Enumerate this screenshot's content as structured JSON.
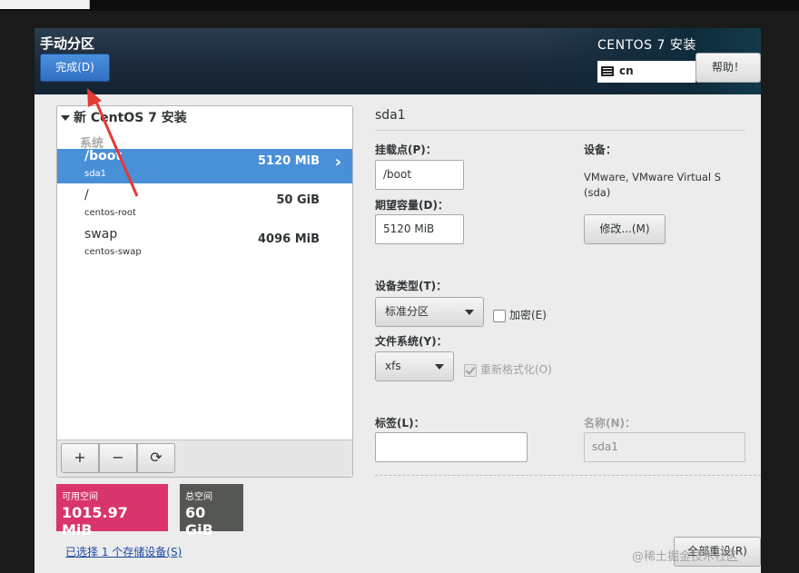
{
  "header": {
    "page_title": "手动分区",
    "done_label": "完成(D)",
    "product_title": "CENTOS 7 安装",
    "keyboard_layout": "cn",
    "help_label": "帮助！"
  },
  "partitions": {
    "install_label": "新 CentOS 7 安装",
    "system_label": "系统",
    "items": [
      {
        "mount": "/boot",
        "device": "sda1",
        "size": "5120 MiB",
        "selected": true
      },
      {
        "mount": "/",
        "device": "centos-root",
        "size": "50 GiB",
        "selected": false
      },
      {
        "mount": "swap",
        "device": "centos-swap",
        "size": "4096 MiB",
        "selected": false
      }
    ],
    "toolbar": {
      "add": "+",
      "remove": "−",
      "refresh": "⟳"
    }
  },
  "space": {
    "available_label": "可用空间",
    "available_value": "1015.97 MiB",
    "total_label": "总空间",
    "total_value": "60 GiB",
    "storage_link": "已选择 1 个存储设备(S)"
  },
  "details": {
    "title": "sda1",
    "mount_label": "挂载点(P)：",
    "mount_value": "/boot",
    "capacity_label": "期望容量(D)：",
    "capacity_value": "5120 MiB",
    "device_label": "设备：",
    "device_value": "VMware, VMware Virtual S (sda)",
    "modify_label": "修改...(M)",
    "device_type_label": "设备类型(T)：",
    "device_type_value": "标准分区",
    "encrypt_label": "加密(E)",
    "filesystem_label": "文件系统(Y)：",
    "filesystem_value": "xfs",
    "reformat_label": "重新格式化(O)",
    "tag_label": "标签(L)：",
    "tag_value": "",
    "name_label": "名称(N)：",
    "name_value": "sda1",
    "reset_label": "全部重设(R)"
  },
  "watermark": "@稀土掘金技术社区",
  "colors": {
    "accent_blue": "#4a90d9",
    "available_space": "#d9346d",
    "total_space": "#555753",
    "annotation_arrow": "#e53935"
  }
}
